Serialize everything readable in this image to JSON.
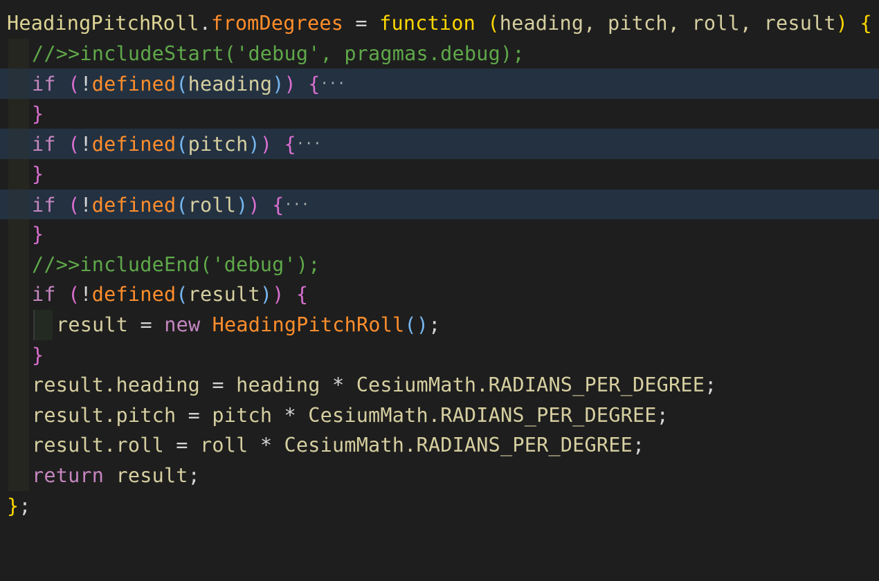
{
  "colors": {
    "background": "#1e1e1e",
    "folded_line": "#233141",
    "type": "#ded595",
    "function_name": "#ff8e2c",
    "keyword_function": "#ffd700",
    "comment": "#5fa84a",
    "control_keyword": "#c586c0",
    "inner_paren": "#77b7f0"
  },
  "lines": {
    "l1": {
      "obj": "HeadingPitchRoll",
      "dot": ".",
      "method": "fromDegrees",
      "eq": " = ",
      "kw": "function",
      "sp": " ",
      "open": "(",
      "params": "heading, pitch, roll, result",
      "close": ")",
      "brace": " {"
    },
    "l2": {
      "comment": "//>>includeStart('debug', pragmas.debug);"
    },
    "l3": {
      "kw": "if",
      "sp": " ",
      "p1": "(",
      "bang": "!",
      "fn": "defined",
      "p2": "(",
      "arg": "heading",
      "p3": ")",
      "p4": ")",
      "brace": " {",
      "ellipsis": "···"
    },
    "l4": {
      "brace": "}"
    },
    "l5": {
      "kw": "if",
      "sp": " ",
      "p1": "(",
      "bang": "!",
      "fn": "defined",
      "p2": "(",
      "arg": "pitch",
      "p3": ")",
      "p4": ")",
      "brace": " {",
      "ellipsis": "···"
    },
    "l6": {
      "brace": "}"
    },
    "l7": {
      "kw": "if",
      "sp": " ",
      "p1": "(",
      "bang": "!",
      "fn": "defined",
      "p2": "(",
      "arg": "roll",
      "p3": ")",
      "p4": ")",
      "brace": " {",
      "ellipsis": "···"
    },
    "l8": {
      "brace": "}"
    },
    "l9": {
      "comment": "//>>includeEnd('debug');"
    },
    "l10": {
      "kw": "if",
      "sp": " ",
      "p1": "(",
      "bang": "!",
      "fn": "defined",
      "p2": "(",
      "arg": "result",
      "p3": ")",
      "p4": ")",
      "brace": " {"
    },
    "l11": {
      "var": "result",
      "eq": " = ",
      "new": "new",
      "sp": " ",
      "cls": "HeadingPitchRoll",
      "open": "(",
      "close": ")",
      "semi": ";"
    },
    "l12": {
      "brace": "}"
    },
    "l13": {
      "lhs": "result.heading",
      "eq": " = ",
      "rhs": "heading",
      "op": " * ",
      "const": "CesiumMath.RADIANS_PER_DEGREE",
      "semi": ";"
    },
    "l14": {
      "lhs": "result.pitch",
      "eq": " = ",
      "rhs": "pitch",
      "op": " * ",
      "const": "CesiumMath.RADIANS_PER_DEGREE",
      "semi": ";"
    },
    "l15": {
      "lhs": "result.roll",
      "eq": " = ",
      "rhs": "roll",
      "op": " * ",
      "const": "CesiumMath.RADIANS_PER_DEGREE",
      "semi": ";"
    },
    "l16": {
      "kw": "return",
      "sp": " ",
      "val": "result",
      "semi": ";"
    },
    "l17": {
      "brace": "}",
      "semi": ";"
    }
  }
}
